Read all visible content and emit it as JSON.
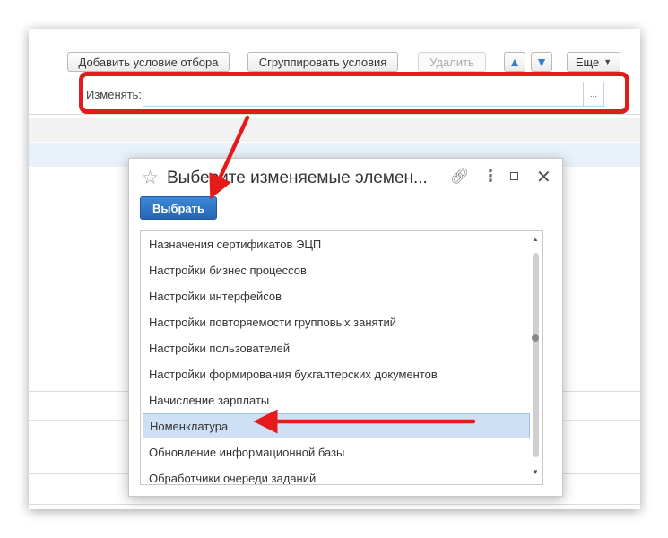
{
  "toolbar": {
    "add_condition_label": "Добавить условие отбора",
    "group_conditions_label": "Сгруппировать условия",
    "delete_label": "Удалить",
    "more_label": "Еще",
    "up_arrow": "🡅",
    "down_arrow": "🡇"
  },
  "field": {
    "label": "Изменять:",
    "value": "",
    "select_dots": "..."
  },
  "dialog": {
    "title": "Выберите изменяемые элемен...",
    "select_button_label": "Выбрать",
    "items": [
      {
        "label": "Назначения сертификатов ЭЦП"
      },
      {
        "label": "Настройки бизнес процессов"
      },
      {
        "label": "Настройки интерфейсов"
      },
      {
        "label": "Настройки повторяемости групповых занятий"
      },
      {
        "label": "Настройки пользователей"
      },
      {
        "label": "Настройки формирования бухгалтерских документов"
      },
      {
        "label": "Начисление зарплаты"
      },
      {
        "label": "Номенклатура"
      },
      {
        "label": "Обновление информационной базы"
      },
      {
        "label": "Обработчики очереди заданий"
      }
    ],
    "selected_item": "Номенклатура"
  },
  "colors": {
    "annotation_red": "#e51b1b",
    "accent_blue": "#2466b6",
    "selection": "#cde0f5"
  },
  "icons": {
    "star": "star-icon",
    "link": "link-icon",
    "more": "more-vertical-icon",
    "maximize": "maximize-icon",
    "close": "close-icon"
  }
}
